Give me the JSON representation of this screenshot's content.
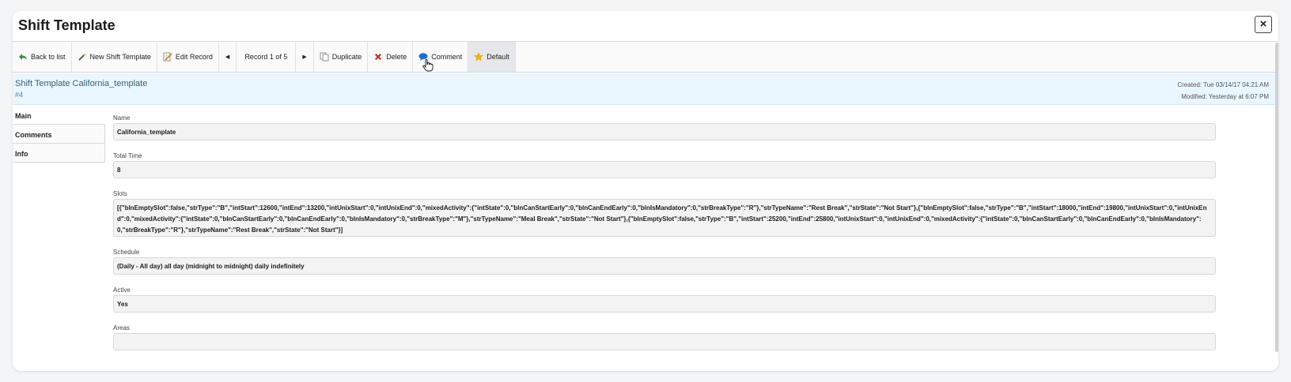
{
  "modal": {
    "title": "Shift Template",
    "close_label": "×"
  },
  "toolbar": {
    "back_label": "Back to list",
    "new_label": "New Shift Template",
    "edit_label": "Edit Record",
    "prev_label": "◀",
    "record_label": "Record 1 of 5",
    "next_label": "▶",
    "duplicate_label": "Duplicate",
    "delete_label": "Delete",
    "comment_label": "Comment",
    "default_label": "Default"
  },
  "record": {
    "title": "Shift Template California_template",
    "id": "#4",
    "created": "Created: Tue 03/14/17 04:21 AM",
    "modified": "Modified: Yesterday at 6:07 PM"
  },
  "side_tabs": [
    {
      "label": "Main"
    },
    {
      "label": "Comments"
    },
    {
      "label": "Info"
    }
  ],
  "fields": {
    "name": {
      "label": "Name",
      "value": "California_template"
    },
    "total_time": {
      "label": "Total Time",
      "value": "8"
    },
    "slots": {
      "label": "Slots",
      "value": "[{\"blnEmptySlot\":false,\"strType\":\"B\",\"intStart\":12600,\"intEnd\":13200,\"intUnixStart\":0,\"intUnixEnd\":0,\"mixedActivity\":{\"intState\":0,\"blnCanStartEarly\":0,\"blnCanEndEarly\":0,\"blnIsMandatory\":0,\"strBreakType\":\"R\"},\"strTypeName\":\"Rest Break\",\"strState\":\"Not Start\"},{\"blnEmptySlot\":false,\"strType\":\"B\",\"intStart\":18000,\"intEnd\":19800,\"intUnixStart\":0,\"intUnixEnd\":0,\"mixedActivity\":{\"intState\":0,\"blnCanStartEarly\":0,\"blnCanEndEarly\":0,\"blnIsMandatory\":0,\"strBreakType\":\"M\"},\"strTypeName\":\"Meal Break\",\"strState\":\"Not Start\"},{\"blnEmptySlot\":false,\"strType\":\"B\",\"intStart\":25200,\"intEnd\":25800,\"intUnixStart\":0,\"intUnixEnd\":0,\"mixedActivity\":{\"intState\":0,\"blnCanStartEarly\":0,\"blnCanEndEarly\":0,\"blnIsMandatory\":0,\"strBreakType\":\"R\"},\"strTypeName\":\"Rest Break\",\"strState\":\"Not Start\"}]"
    },
    "schedule": {
      "label": "Schedule",
      "value": "(Daily - All day) all day (midnight to midnight) daily indefinitely"
    },
    "active": {
      "label": "Active",
      "value": "Yes"
    },
    "areas": {
      "label": "Areas",
      "value": ""
    }
  },
  "colors": {
    "record_header_bg": "#eaf6fd",
    "record_title": "#3a5e74",
    "delete_icon": "#c62828",
    "comment_icon": "#1e6fd0",
    "default_icon": "#f0b400"
  },
  "icons": {
    "back": "back-arrow-icon",
    "new": "magic-wand-icon",
    "edit": "edit-pencil-icon",
    "duplicate": "duplicate-icon",
    "delete": "delete-x-icon",
    "comment": "speech-bubble-icon",
    "default": "star-icon",
    "cursor": "hand-pointer-icon"
  }
}
